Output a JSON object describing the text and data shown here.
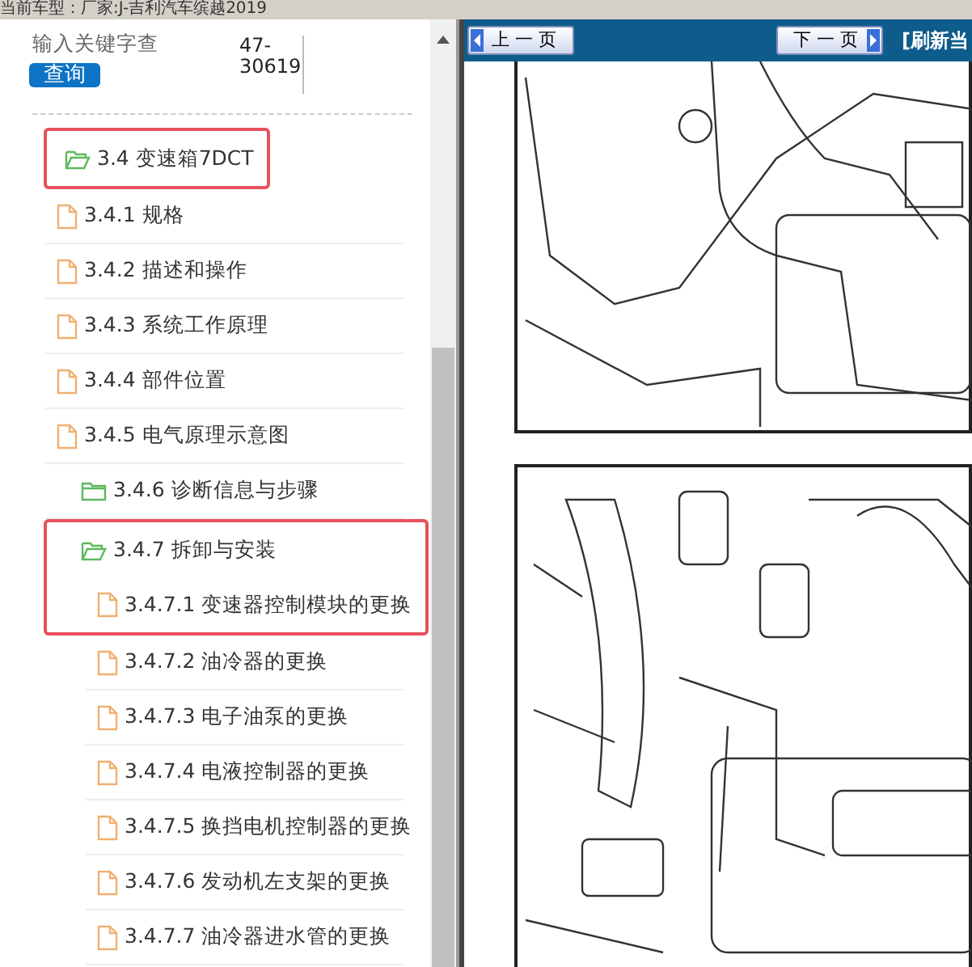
{
  "header": {
    "vehicle": "当前车型：厂家:J-吉利汽车缤越2019"
  },
  "search": {
    "placeholder": "输入关键字查",
    "button": "查询",
    "code": "47-30619"
  },
  "tree": [
    {
      "label": "3.4 变速箱7DCT",
      "kind": "folder",
      "expanded": true,
      "highlighted": true,
      "children": [
        {
          "label": "3.4.1 规格",
          "kind": "file",
          "highlighted": false
        },
        {
          "label": "3.4.2 描述和操作",
          "kind": "file",
          "highlighted": false
        },
        {
          "label": "3.4.3 系统工作原理",
          "kind": "file",
          "highlighted": false
        },
        {
          "label": "3.4.4 部件位置",
          "kind": "file",
          "highlighted": false
        },
        {
          "label": "3.4.5 电气原理示意图",
          "kind": "file",
          "highlighted": false
        },
        {
          "label": "3.4.6 诊断信息与步骤",
          "kind": "folder",
          "expanded": false,
          "highlighted": false
        },
        {
          "label": "3.4.7 拆卸与安装",
          "kind": "folder",
          "expanded": true,
          "highlighted": true,
          "children": [
            {
              "label": "3.4.7.1 变速器控制模块的更换",
              "kind": "file",
              "highlighted": true
            },
            {
              "label": "3.4.7.2 油冷器的更换",
              "kind": "file",
              "highlighted": false
            },
            {
              "label": "3.4.7.3 电子油泵的更换",
              "kind": "file",
              "highlighted": false
            },
            {
              "label": "3.4.7.4 电液控制器的更换",
              "kind": "file",
              "highlighted": false
            },
            {
              "label": "3.4.7.5 换挡电机控制器的更换",
              "kind": "file",
              "highlighted": false
            },
            {
              "label": "3.4.7.6 发动机左支架的更换",
              "kind": "file",
              "highlighted": false
            },
            {
              "label": "3.4.7.7 油冷器进水管的更换",
              "kind": "file",
              "highlighted": false
            }
          ]
        }
      ]
    }
  ],
  "viewer": {
    "prev_button": "上 一 页",
    "next_button": "下 一 页",
    "refresh_link": "[刷新当"
  }
}
